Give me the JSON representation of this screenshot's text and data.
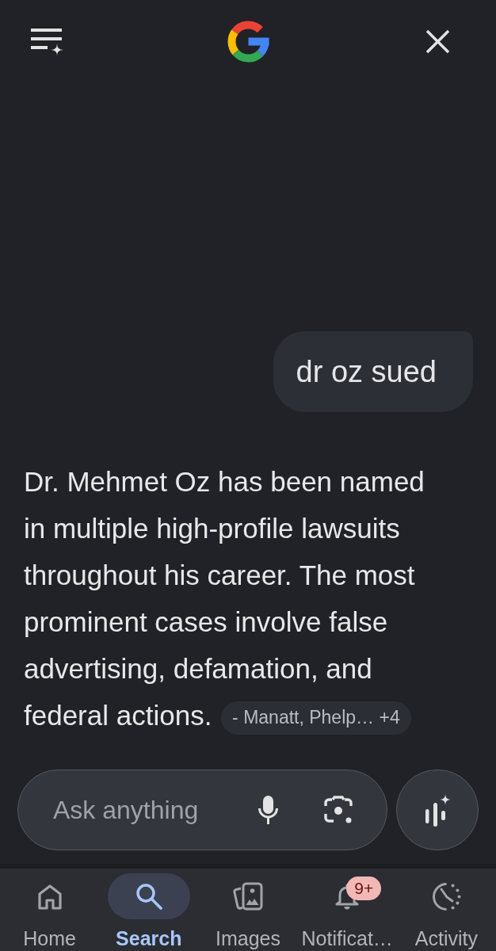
{
  "query": {
    "text": "dr oz sued"
  },
  "answer": {
    "text": "Dr. Mehmet Oz has been named in multiple high-profile lawsuits throughout his career. The most prominent cases involve false advertising, defamation, and federal actions.",
    "source_chip": "- Manatt, Phelp… +4"
  },
  "input": {
    "placeholder": "Ask anything"
  },
  "bottom_nav": [
    {
      "label": "Home",
      "selected": false
    },
    {
      "label": "Search",
      "selected": true
    },
    {
      "label": "Images",
      "selected": false
    },
    {
      "label": "Notificat…",
      "selected": false,
      "badge": "9+"
    },
    {
      "label": "Activity",
      "selected": false
    }
  ]
}
